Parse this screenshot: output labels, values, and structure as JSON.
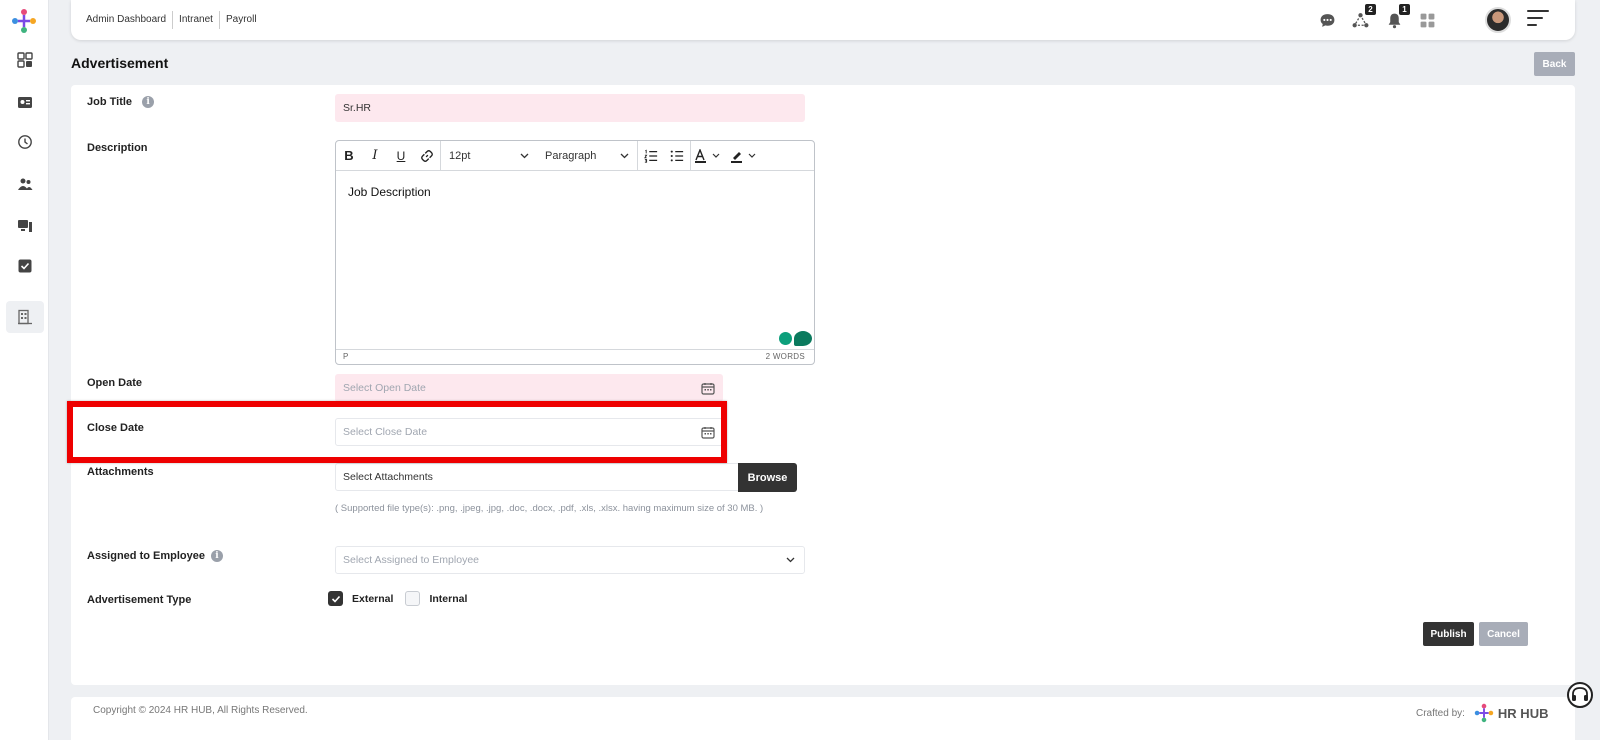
{
  "app": {
    "brand": "HR HUB"
  },
  "breadcrumbs": [
    "Admin Dashboard",
    "Intranet",
    "Payroll"
  ],
  "topbar": {
    "chat_icon": "chat-icon",
    "network_badge": "2",
    "notification_badge": "1"
  },
  "page": {
    "title": "Advertisement",
    "back_label": "Back"
  },
  "form": {
    "job_title": {
      "label": "Job Title",
      "value": "Sr.HR"
    },
    "description": {
      "label": "Description",
      "font_size": "12pt",
      "block_format": "Paragraph",
      "content": "Job Description",
      "status_path": "P",
      "word_count": "2 WORDS"
    },
    "open_date": {
      "label": "Open Date",
      "placeholder": "Select Open Date"
    },
    "close_date": {
      "label": "Close Date",
      "placeholder": "Select Close Date"
    },
    "attachments": {
      "label": "Attachments",
      "placeholder": "Select Attachments",
      "browse_label": "Browse",
      "hint": "( Supported file type(s): .png, .jpeg, .jpg, .doc, .docx, .pdf, .xls, .xlsx. having maximum size of 30 MB. )"
    },
    "assigned": {
      "label": "Assigned to Employee",
      "placeholder": "Select Assigned to Employee"
    },
    "ad_type": {
      "label": "Advertisement Type",
      "options": [
        {
          "label": "External",
          "checked": true
        },
        {
          "label": "Internal",
          "checked": false
        }
      ]
    }
  },
  "actions": {
    "publish": "Publish",
    "cancel": "Cancel"
  },
  "footer": {
    "copyright": "Copyright © 2024 HR HUB, All Rights Reserved.",
    "crafted_by": "Crafted by:",
    "brand": "HR HUB"
  },
  "colors": {
    "accent": "#333333",
    "highlight": "#ee0000",
    "required_field": "#fde8ee"
  }
}
